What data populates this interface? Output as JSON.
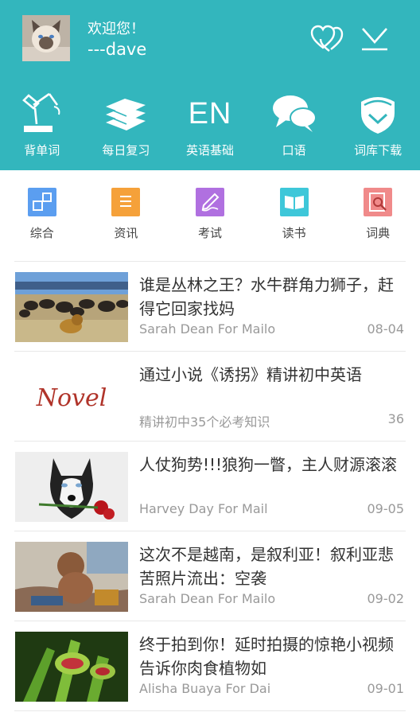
{
  "header": {
    "greeting": "欢迎您！",
    "username": "---dave",
    "accent_color": "#33b6bd",
    "icons": [
      "avatar",
      "hearts-icon",
      "download-icon"
    ]
  },
  "functions": [
    {
      "label": "背单词",
      "icon": "desk-lamp-icon"
    },
    {
      "label": "每日复习",
      "icon": "books-icon"
    },
    {
      "label": "英语基础",
      "icon_text": "EN"
    },
    {
      "label": "口语",
      "icon": "speech-bubbles-icon"
    },
    {
      "label": "词库下载",
      "icon": "download-shield-icon"
    }
  ],
  "categories": [
    {
      "label": "综合",
      "color": "#5b9ef0",
      "icon": "squares-icon"
    },
    {
      "label": "资讯",
      "color": "#f5a13a",
      "icon": "document-icon"
    },
    {
      "label": "考试",
      "color": "#b070e0",
      "icon": "pen-icon"
    },
    {
      "label": "读书",
      "color": "#3ec7d9",
      "icon": "book-icon"
    },
    {
      "label": "词典",
      "color": "#f08a8a",
      "icon": "magnifier-icon"
    }
  ],
  "news": [
    {
      "title": "谁是丛林之王？水牛群角力狮子，赶得它回家找妈",
      "sub": "Sarah Dean For Mailo",
      "meta": "08-04",
      "thumb": "buffalo-lion-photo"
    },
    {
      "title": "通过小说《诱拐》精讲初中英语",
      "sub": "精讲初中35个必考知识",
      "meta": "36",
      "thumb": "novel-text",
      "thumb_text": "Novel"
    },
    {
      "title": "人仗狗势!!!狼狗一瞥，主人财源滚滚",
      "sub": "Harvey Day For Mail",
      "meta": "09-05",
      "thumb": "husky-photo"
    },
    {
      "title": "这次不是越南，是叙利亚！叙利亚悲苦照片流出：空袭",
      "sub": "Sarah Dean For Mailo",
      "meta": "09-02",
      "thumb": "child-photo"
    },
    {
      "title": "终于拍到你！延时拍摄的惊艳小视频告诉你肉食植物如",
      "sub": "Alisha Buaya For Dai",
      "meta": "09-01",
      "thumb": "flytrap-photo"
    }
  ]
}
